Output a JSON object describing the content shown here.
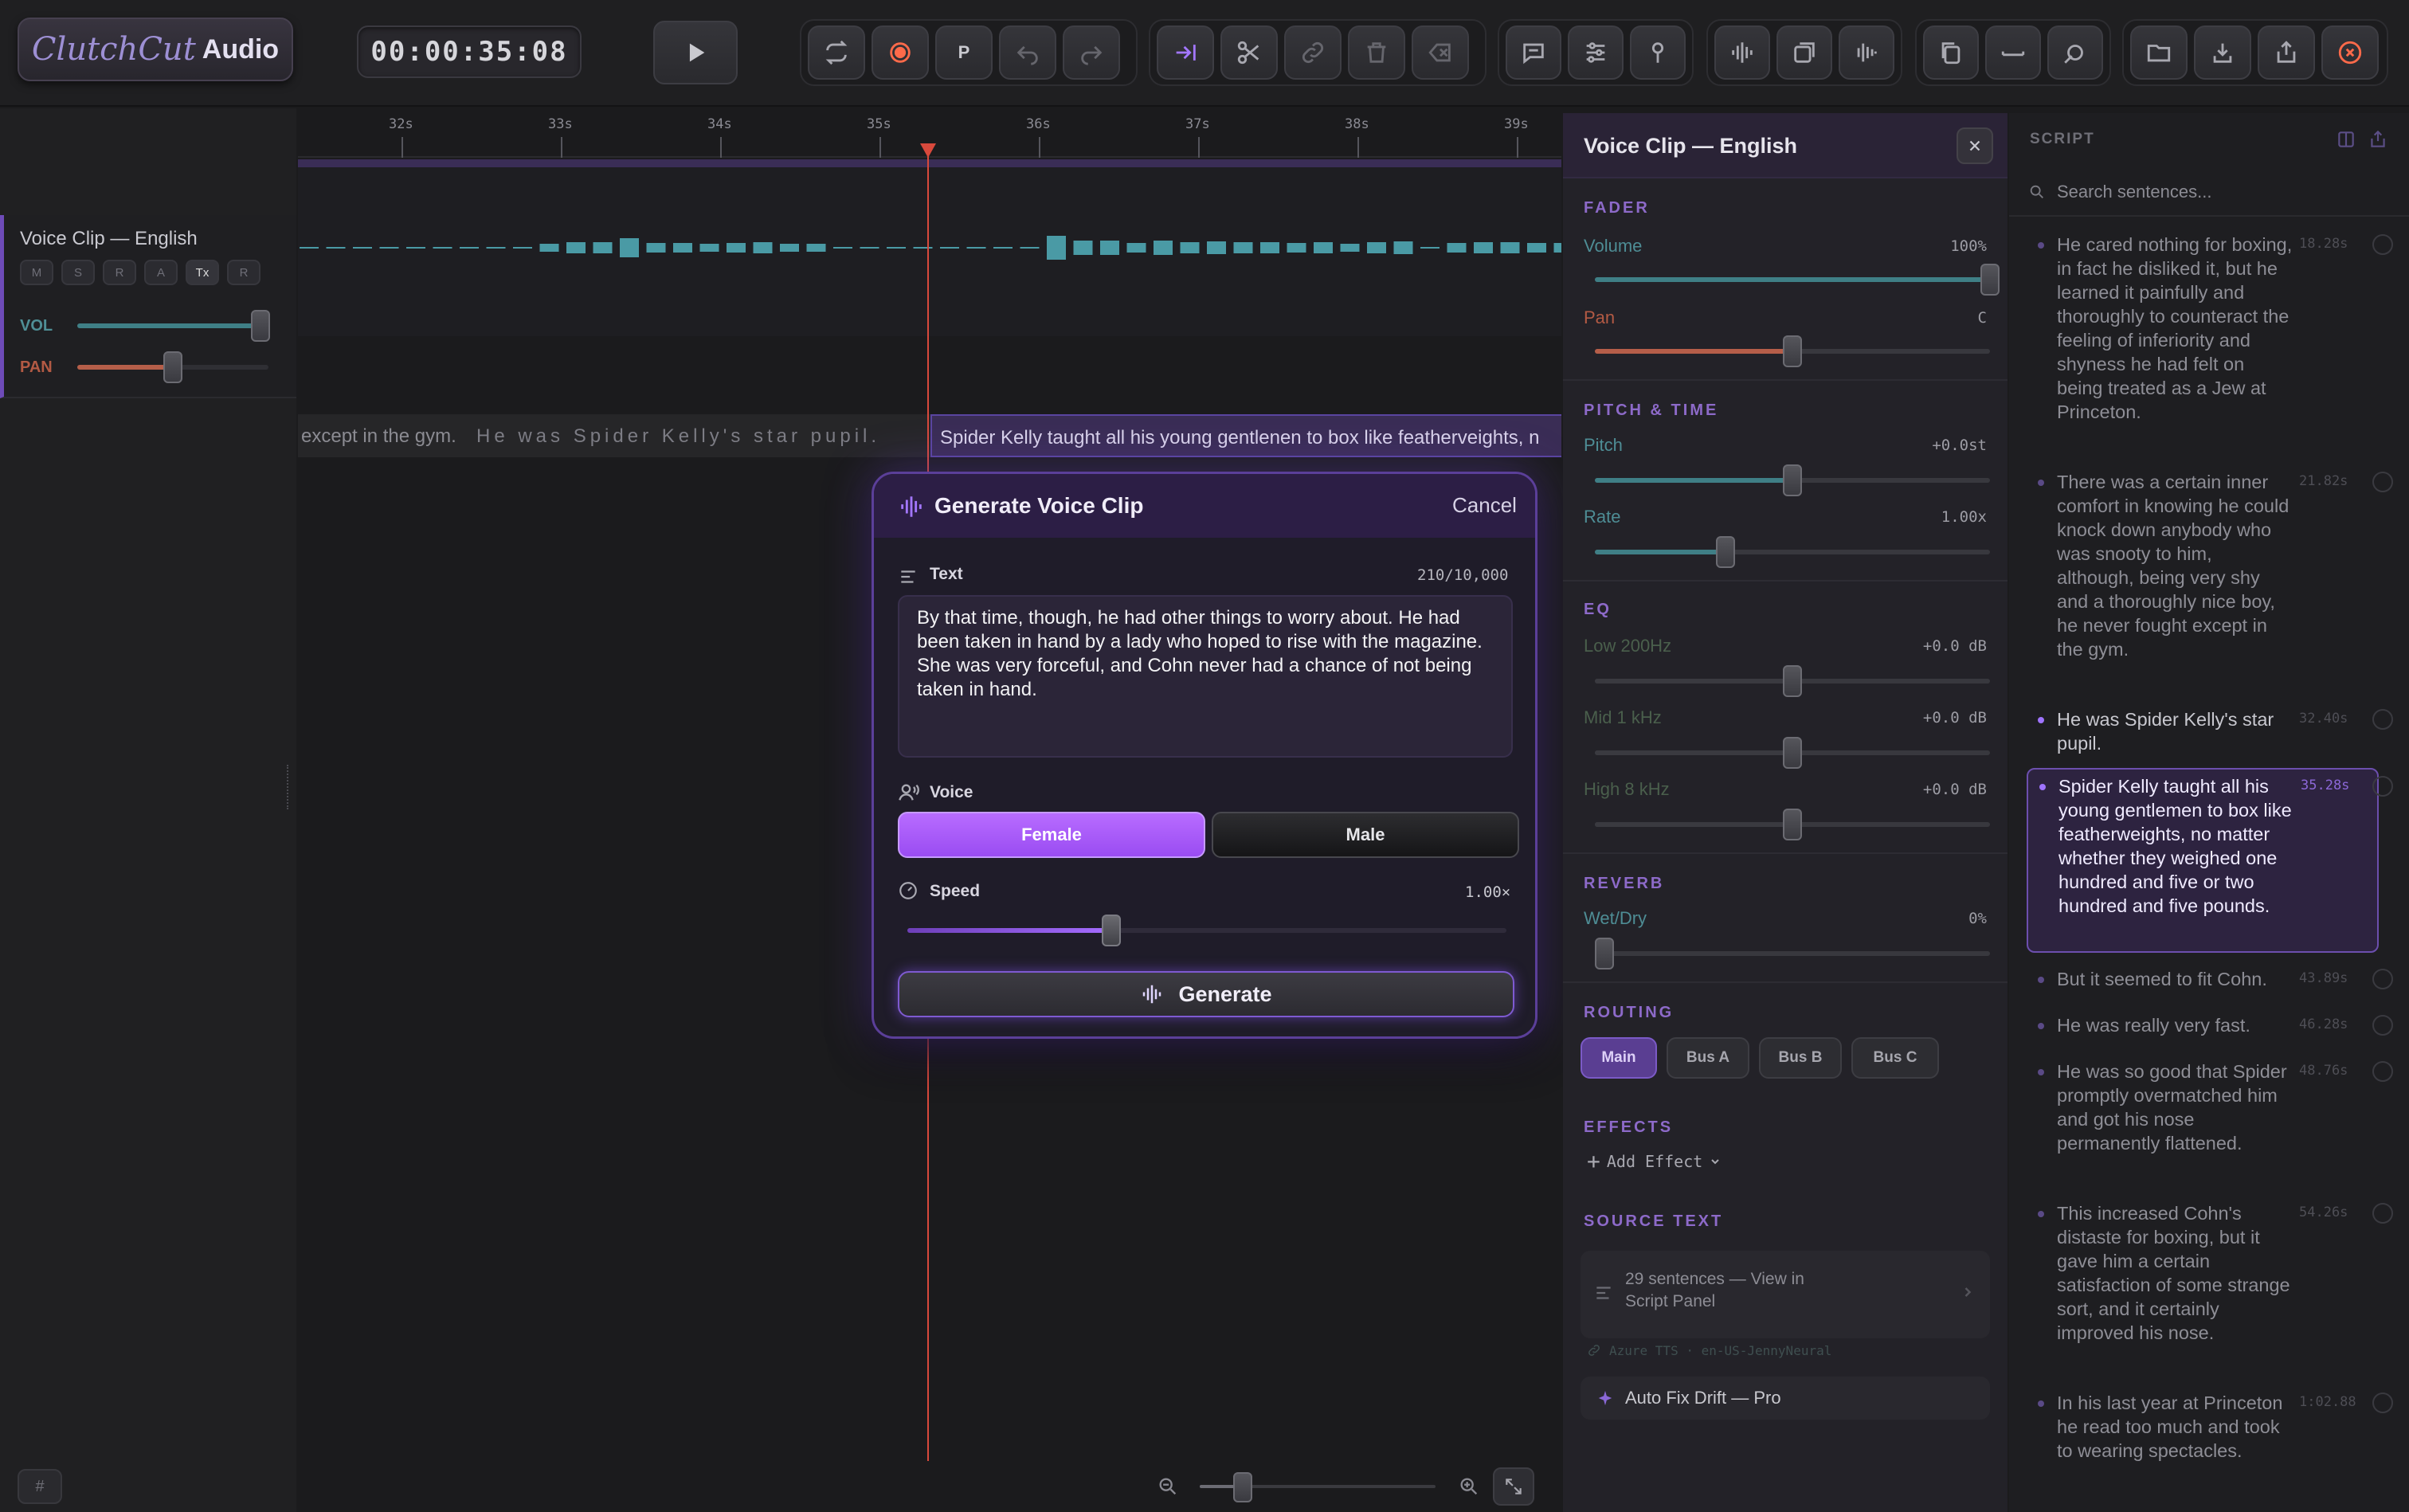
{
  "app": {
    "logo_script": "ClutchCut",
    "logo_bold": "Audio",
    "timecode": "00:00:35:08"
  },
  "toolbar": {
    "p_label": "P"
  },
  "accent": {
    "purple": "#9b6bff",
    "record": "#ff6a4a",
    "playhead": "#d8493c",
    "vol_fill": "#3f7f86",
    "pan_fill": "#b55e49"
  },
  "timeline": {
    "ticks": [
      "32s",
      "33s",
      "34s",
      "35s",
      "36s",
      "37s",
      "38s",
      "39s"
    ],
    "playhead_time": "35s",
    "subtitles": {
      "prev": "except in the gym.",
      "played": "He was Spider Kelly's star pupil.",
      "current": "Spider Kelly taught all his young gentlenen to box like featherveights, n"
    }
  },
  "track": {
    "name": "Voice Clip — English",
    "buttons": [
      "M",
      "S",
      "R",
      "A",
      "Tx",
      "R"
    ],
    "active_button": "Tx",
    "vol_label": "VOL",
    "pan_label": "PAN",
    "vol_level": 1.0,
    "pan_level": 0.5
  },
  "dialog": {
    "title": "Generate Voice Clip",
    "cancel": "Cancel",
    "text_label": "Text",
    "char_count": "210/10,000",
    "text_value": "By that time, though, he had other things to worry about. He had been taken in hand by a lady who hoped to rise with the magazine. She was very forceful, and Cohn never had a chance of not being taken in hand.",
    "voice_label": "Voice",
    "voices": [
      "Female",
      "Male"
    ],
    "selected_voice": "Female",
    "speed_label": "Speed",
    "speed_value": "1.00×",
    "speed_level": 0.34,
    "generate_label": "Generate"
  },
  "inspector": {
    "title": "Voice Clip — English",
    "fader": {
      "heading": "FADER",
      "volume_label": "Volume",
      "volume_value": "100%",
      "volume_level": 1.0,
      "pan_label": "Pan",
      "pan_value": "C",
      "pan_level": 0.5
    },
    "pitch_time": {
      "heading": "PITCH & TIME",
      "pitch_label": "Pitch",
      "pitch_value": "+0.0st",
      "pitch_level": 0.5,
      "rate_label": "Rate",
      "rate_value": "1.00x",
      "rate_level": 0.33
    },
    "eq": {
      "heading": "EQ",
      "bands": [
        {
          "label": "Low  200Hz",
          "value": "+0.0 dB",
          "level": 0.5
        },
        {
          "label": "Mid  1 kHz",
          "value": "+0.0 dB",
          "level": 0.5
        },
        {
          "label": "High 8 kHz",
          "value": "+0.0 dB",
          "level": 0.5
        }
      ]
    },
    "reverb": {
      "heading": "REVERB",
      "label": "Wet/Dry",
      "value": "0%",
      "level": 0.0
    },
    "routing": {
      "heading": "ROUTING",
      "options": [
        "Main",
        "Bus A",
        "Bus B",
        "Bus C"
      ],
      "selected": "Main"
    },
    "effects": {
      "heading": "EFFECTS",
      "add_label": "Add Effect"
    },
    "source": {
      "heading": "SOURCE TEXT",
      "line1": "29 sentences  —  View in",
      "line2": "Script Panel",
      "engine": "Azure TTS · en-US-JennyNeural"
    },
    "autofix_label": "Auto Fix Drift — Pro"
  },
  "script": {
    "title": "SCRIPT",
    "search_placeholder": "Search sentences...",
    "items": [
      {
        "text": "He cared nothing for boxing, in fact he disliked it, but he learned it painfully and thoroughly to counteract the feeling of inferiority and shyness he had felt on being treated as a Jew at Princeton.",
        "time": "18.28s",
        "state": "upcoming"
      },
      {
        "text": "There was a certain inner comfort in knowing he could knock down anybody who was snooty to him, although, being very shy and a thoroughly nice boy, he never fought except in the gym.",
        "time": "21.82s",
        "state": "upcoming"
      },
      {
        "text": "He was Spider Kelly's star pupil.",
        "time": "32.40s",
        "state": "played"
      },
      {
        "text": "Spider Kelly taught all his young gentlemen to box like featherweights, no matter whether they weighed one hundred and five or two hundred and five pounds.",
        "time": "35.28s",
        "state": "active"
      },
      {
        "text": "But it seemed to fit Cohn.",
        "time": "43.89s",
        "state": "upcoming"
      },
      {
        "text": "He was really very fast.",
        "time": "46.28s",
        "state": "upcoming"
      },
      {
        "text": "He was so good that Spider promptly overmatched him and got his nose permanently flattened.",
        "time": "48.76s",
        "state": "upcoming"
      },
      {
        "text": "This increased Cohn's distaste for boxing, but it gave him a certain satisfaction of some strange sort, and it certainly improved his nose.",
        "time": "54.26s",
        "state": "upcoming"
      },
      {
        "text": "In his last year at Princeton he read too much and took to wearing spectacles.",
        "time": "1:02.88",
        "state": "upcoming"
      }
    ]
  }
}
